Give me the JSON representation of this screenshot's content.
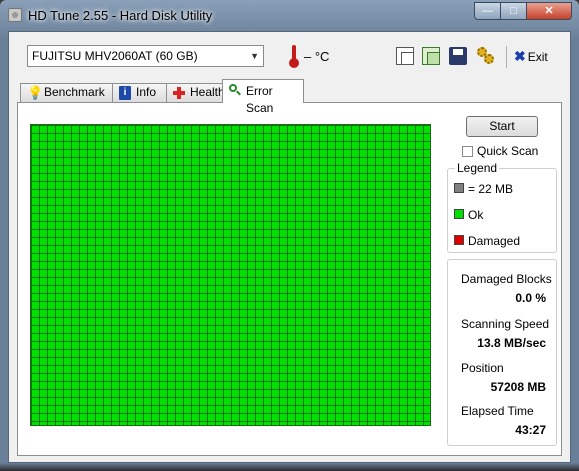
{
  "window": {
    "title": "HD Tune 2.55 - Hard Disk Utility",
    "min_label": "—",
    "max_label": "□",
    "close_label": "✕"
  },
  "toolbar": {
    "drive": "FUJITSU MHV2060AT (60 GB)",
    "drive_arrow": "▼",
    "temperature": "– °C",
    "exit_label": "Exit",
    "exit_icon": "✖"
  },
  "icons": {
    "temperature": "thermometer-icon",
    "copy_text": "copy-text-icon",
    "copy_screenshot": "copy-screenshot-icon",
    "save": "save-icon",
    "options": "gears-icon",
    "exit": "exit-x-icon"
  },
  "tabs": [
    {
      "label": "Benchmark",
      "icon": "lightbulb-icon",
      "active": false
    },
    {
      "label": "Info",
      "icon": "info-icon",
      "active": false
    },
    {
      "label": "Health",
      "icon": "health-cross-icon",
      "active": false
    },
    {
      "label": "Error Scan",
      "icon": "magnifier-icon",
      "active": true
    }
  ],
  "scan": {
    "start_label": "Start",
    "quick_scan_label": "Quick Scan",
    "quick_scan_checked": false,
    "block_status": "Ok",
    "block_color": "#00e000"
  },
  "legend": {
    "title": "Legend",
    "items": [
      {
        "label": "= 22 MB",
        "color": "#808080"
      },
      {
        "label": "Ok",
        "color": "#00e000"
      },
      {
        "label": "Damaged",
        "color": "#e00000"
      }
    ]
  },
  "stats": {
    "damaged_blocks_label": "Damaged Blocks",
    "damaged_blocks_value": "0.0 %",
    "scanning_speed_label": "Scanning Speed",
    "scanning_speed_value": "13.8 MB/sec",
    "position_label": "Position",
    "position_value": "57208 MB",
    "elapsed_label": "Elapsed Time",
    "elapsed_value": "43:27"
  }
}
